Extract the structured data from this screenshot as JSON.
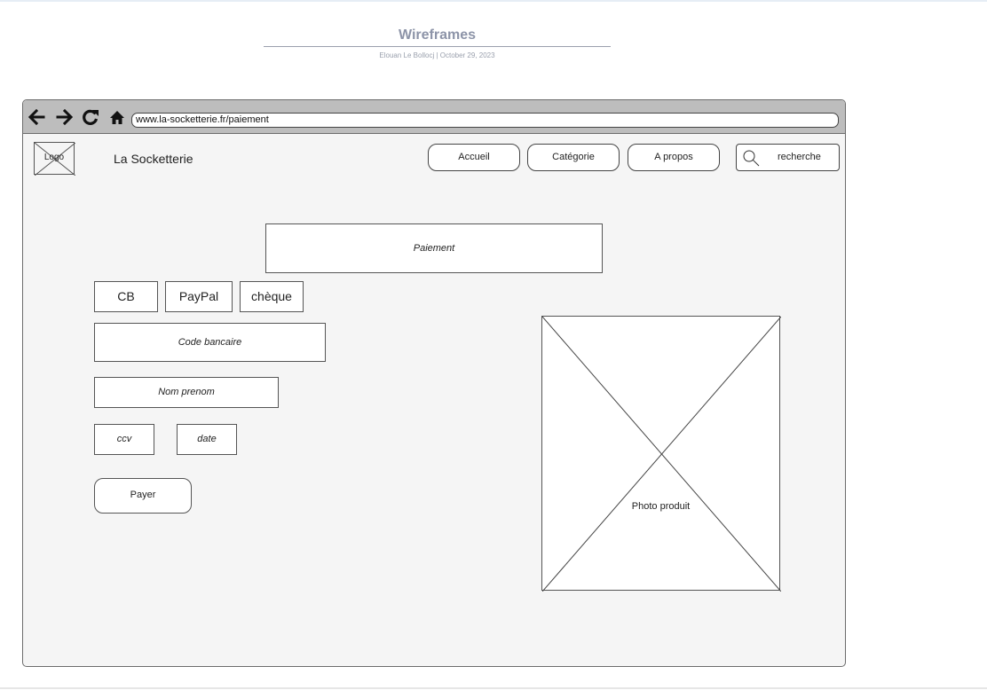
{
  "document": {
    "title": "Wireframes",
    "meta": "Elouan Le Bollocj  |  October 29, 2023"
  },
  "browser": {
    "url": "www.la-socketterie.fr/paiement",
    "icons": [
      "back-arrow-icon",
      "forward-arrow-icon",
      "reload-icon",
      "home-icon"
    ]
  },
  "header": {
    "logo_label": "Logo",
    "site_name": "La Socketterie",
    "nav": [
      "Accueil",
      "Catégorie",
      "A propos"
    ],
    "search_placeholder": "recherche"
  },
  "payment": {
    "title": "Paiement",
    "methods": [
      "CB",
      "PayPal",
      "chèque"
    ],
    "fields": {
      "card_code": "Code bancaire",
      "full_name": "Nom prenom",
      "cvv": "ccv",
      "date": "date"
    },
    "submit_label": "Payer"
  },
  "product": {
    "photo_label": "Photo produit"
  }
}
